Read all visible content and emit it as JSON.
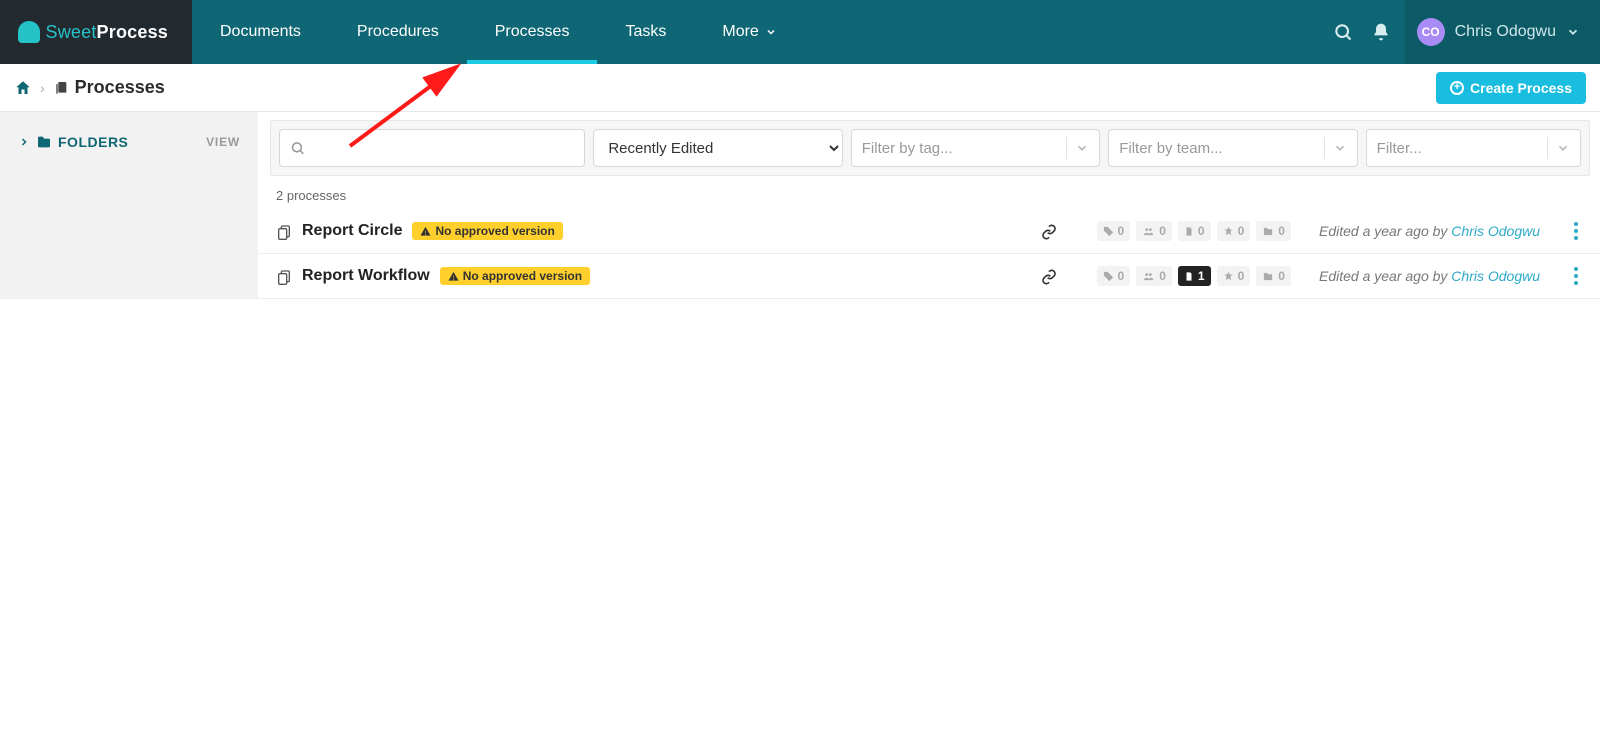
{
  "brand": {
    "left": "Sweet",
    "right": "Process"
  },
  "nav": {
    "documents": "Documents",
    "procedures": "Procedures",
    "processes": "Processes",
    "tasks": "Tasks",
    "more": "More"
  },
  "user": {
    "initials": "CO",
    "name": "Chris Odogwu"
  },
  "breadcrumb": {
    "title": "Processes"
  },
  "create_button": "Create Process",
  "sidebar": {
    "folders": "FOLDERS",
    "view": "VIEW"
  },
  "filters": {
    "sort_selected": "Recently Edited",
    "tag_placeholder": "Filter by tag...",
    "team_placeholder": "Filter by team...",
    "more_placeholder": "Filter..."
  },
  "count_line": "2 processes",
  "badge_label": "No approved version",
  "rows": [
    {
      "title": "Report Circle",
      "counts": {
        "tags": "0",
        "teams": "0",
        "pages": "0",
        "pins": "0",
        "folders": "0"
      },
      "pages_hot": false,
      "edited_prefix": "Edited a year ago by ",
      "editor": "Chris Odogwu"
    },
    {
      "title": "Report Workflow",
      "counts": {
        "tags": "0",
        "teams": "0",
        "pages": "1",
        "pins": "0",
        "folders": "0"
      },
      "pages_hot": true,
      "edited_prefix": "Edited a year ago by ",
      "editor": "Chris Odogwu"
    }
  ]
}
